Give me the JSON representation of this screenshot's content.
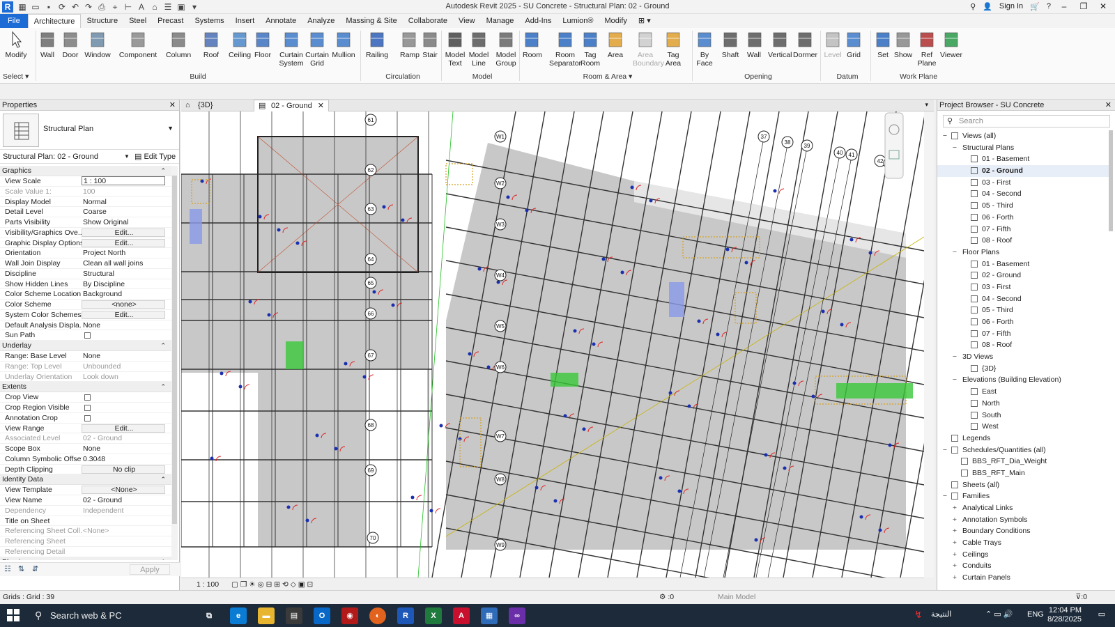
{
  "window": {
    "title": "Autodesk Revit 2025 - SU Concrete - Structural Plan: 02 - Ground",
    "sign_in": "Sign In"
  },
  "ribbon_tabs": [
    "File",
    "Architecture",
    "Structure",
    "Steel",
    "Precast",
    "Systems",
    "Insert",
    "Annotate",
    "Analyze",
    "Massing & Site",
    "Collaborate",
    "View",
    "Manage",
    "Add-Ins",
    "Lumion®",
    "Modify"
  ],
  "ribbon": {
    "select": "Select ▾",
    "tools": [
      {
        "label": "Modify"
      },
      {
        "label": "Wall"
      },
      {
        "label": "Door"
      },
      {
        "label": "Window"
      },
      {
        "label": "Component"
      },
      {
        "label": "Column"
      },
      {
        "label": "Roof"
      },
      {
        "label": "Ceiling"
      },
      {
        "label": "Floor"
      },
      {
        "label": "Curtain\nSystem"
      },
      {
        "label": "Curtain\nGrid"
      },
      {
        "label": "Mullion"
      },
      {
        "label": "Railing"
      },
      {
        "label": "Ramp"
      },
      {
        "label": "Stair"
      },
      {
        "label": "Model\nText"
      },
      {
        "label": "Model\nLine"
      },
      {
        "label": "Model\nGroup"
      },
      {
        "label": "Room"
      },
      {
        "label": "Room\nSeparator"
      },
      {
        "label": "Tag\nRoom"
      },
      {
        "label": "Area"
      },
      {
        "label": "Area\nBoundary"
      },
      {
        "label": "Tag\nArea"
      },
      {
        "label": "By\nFace"
      },
      {
        "label": "Shaft"
      },
      {
        "label": "Wall"
      },
      {
        "label": "Vertical"
      },
      {
        "label": "Dormer"
      },
      {
        "label": "Level"
      },
      {
        "label": "Grid"
      },
      {
        "label": "Set"
      },
      {
        "label": "Show"
      },
      {
        "label": "Ref\nPlane"
      },
      {
        "label": "Viewer"
      }
    ],
    "panels": {
      "build": "Build",
      "circulation": "Circulation",
      "model": "Model",
      "room_area": "Room & Area ▾",
      "opening": "Opening",
      "datum": "Datum",
      "work_plane": "Work Plane"
    }
  },
  "properties": {
    "header": "Properties",
    "type_name": "Structural Plan",
    "instance": "Structural Plan: 02 - Ground",
    "edit_type": "Edit Type",
    "groups": [
      {
        "name": "Graphics",
        "rows": [
          {
            "k": "View Scale",
            "v": "1 : 100",
            "kind": "inp"
          },
          {
            "k": "Scale Value    1:",
            "v": "100",
            "kind": "dim"
          },
          {
            "k": "Display Model",
            "v": "Normal"
          },
          {
            "k": "Detail Level",
            "v": "Coarse"
          },
          {
            "k": "Parts Visibility",
            "v": "Show Original"
          },
          {
            "k": "Visibility/Graphics Ove...",
            "v": "Edit...",
            "kind": "btn"
          },
          {
            "k": "Graphic Display Options",
            "v": "Edit...",
            "kind": "btn"
          },
          {
            "k": "Orientation",
            "v": "Project North"
          },
          {
            "k": "Wall Join Display",
            "v": "Clean all wall joins"
          },
          {
            "k": "Discipline",
            "v": "Structural"
          },
          {
            "k": "Show Hidden Lines",
            "v": "By Discipline"
          },
          {
            "k": "Color Scheme Location",
            "v": "Background"
          },
          {
            "k": "Color Scheme",
            "v": "<none>",
            "kind": "btn"
          },
          {
            "k": "System Color Schemes",
            "v": "Edit...",
            "kind": "btn"
          },
          {
            "k": "Default Analysis Displa...",
            "v": "None"
          },
          {
            "k": "Sun Path",
            "v": "",
            "kind": "chk"
          }
        ]
      },
      {
        "name": "Underlay",
        "rows": [
          {
            "k": "Range: Base Level",
            "v": "None"
          },
          {
            "k": "Range: Top Level",
            "v": "Unbounded",
            "kind": "dim"
          },
          {
            "k": "Underlay Orientation",
            "v": "Look down",
            "kind": "dim"
          }
        ]
      },
      {
        "name": "Extents",
        "rows": [
          {
            "k": "Crop View",
            "v": "",
            "kind": "chk"
          },
          {
            "k": "Crop Region Visible",
            "v": "",
            "kind": "chk"
          },
          {
            "k": "Annotation Crop",
            "v": "",
            "kind": "chk"
          },
          {
            "k": "View Range",
            "v": "Edit...",
            "kind": "btn"
          },
          {
            "k": "Associated Level",
            "v": "02 - Ground",
            "kind": "dim"
          },
          {
            "k": "Scope Box",
            "v": "None"
          },
          {
            "k": "Column Symbolic Offset",
            "v": "0.3048"
          },
          {
            "k": "Depth Clipping",
            "v": "No clip",
            "kind": "btn"
          }
        ]
      },
      {
        "name": "Identity Data",
        "rows": [
          {
            "k": "View Template",
            "v": "<None>",
            "kind": "btn"
          },
          {
            "k": "View Name",
            "v": "02 - Ground"
          },
          {
            "k": "Dependency",
            "v": "Independent",
            "kind": "dim"
          },
          {
            "k": "Title on Sheet",
            "v": ""
          },
          {
            "k": "Referencing Sheet Coll...",
            "v": "<None>",
            "kind": "dim"
          },
          {
            "k": "Referencing Sheet",
            "v": "",
            "kind": "dim"
          },
          {
            "k": "Referencing Detail",
            "v": "",
            "kind": "dim"
          }
        ]
      },
      {
        "name": "Phasing",
        "rows": []
      }
    ],
    "apply": "Apply"
  },
  "view_tabs": [
    {
      "label": "{3D}",
      "active": false
    },
    {
      "label": "02 - Ground",
      "active": true
    }
  ],
  "view_control": {
    "scale": "1 : 100"
  },
  "browser": {
    "header": "Project Browser - SU Concrete",
    "search_placeholder": "Search",
    "tree": [
      {
        "label": "Views (all)",
        "lvl": 0,
        "tg": "−",
        "ic": true
      },
      {
        "label": "Structural Plans",
        "lvl": 1,
        "tg": "−"
      },
      {
        "label": "01 - Basement",
        "lvl": 2,
        "ic": true
      },
      {
        "label": "02 - Ground",
        "lvl": 2,
        "ic": true,
        "sel": true
      },
      {
        "label": "03 - First",
        "lvl": 2,
        "ic": true
      },
      {
        "label": "04 - Second",
        "lvl": 2,
        "ic": true
      },
      {
        "label": "05 - Third",
        "lvl": 2,
        "ic": true
      },
      {
        "label": "06 - Forth",
        "lvl": 2,
        "ic": true
      },
      {
        "label": "07 - Fifth",
        "lvl": 2,
        "ic": true
      },
      {
        "label": "08 - Roof",
        "lvl": 2,
        "ic": true
      },
      {
        "label": "Floor Plans",
        "lvl": 1,
        "tg": "−"
      },
      {
        "label": "01 - Basement",
        "lvl": 2,
        "ic": true
      },
      {
        "label": "02 - Ground",
        "lvl": 2,
        "ic": true
      },
      {
        "label": "03 - First",
        "lvl": 2,
        "ic": true
      },
      {
        "label": "04 - Second",
        "lvl": 2,
        "ic": true
      },
      {
        "label": "05 - Third",
        "lvl": 2,
        "ic": true
      },
      {
        "label": "06 - Forth",
        "lvl": 2,
        "ic": true
      },
      {
        "label": "07 - Fifth",
        "lvl": 2,
        "ic": true
      },
      {
        "label": "08 - Roof",
        "lvl": 2,
        "ic": true
      },
      {
        "label": "3D Views",
        "lvl": 1,
        "tg": "−"
      },
      {
        "label": "{3D}",
        "lvl": 2,
        "ic": true
      },
      {
        "label": "Elevations (Building Elevation)",
        "lvl": 1,
        "tg": "−"
      },
      {
        "label": "East",
        "lvl": 2,
        "ic": true
      },
      {
        "label": "North",
        "lvl": 2,
        "ic": true
      },
      {
        "label": "South",
        "lvl": 2,
        "ic": true
      },
      {
        "label": "West",
        "lvl": 2,
        "ic": true
      },
      {
        "label": "Legends",
        "lvl": 0,
        "ic": true
      },
      {
        "label": "Schedules/Quantities (all)",
        "lvl": 0,
        "tg": "−",
        "ic": true
      },
      {
        "label": "BBS_RFT_Dia_Weight",
        "lvl": 1,
        "ic": true
      },
      {
        "label": "BBS_RFT_Main",
        "lvl": 1,
        "ic": true
      },
      {
        "label": "Sheets (all)",
        "lvl": 0,
        "ic": true
      },
      {
        "label": "Families",
        "lvl": 0,
        "tg": "−",
        "ic": true
      },
      {
        "label": "Analytical Links",
        "lvl": 1,
        "tg": "+"
      },
      {
        "label": "Annotation Symbols",
        "lvl": 1,
        "tg": "+"
      },
      {
        "label": "Boundary Conditions",
        "lvl": 1,
        "tg": "+"
      },
      {
        "label": "Cable Trays",
        "lvl": 1,
        "tg": "+"
      },
      {
        "label": "Ceilings",
        "lvl": 1,
        "tg": "+"
      },
      {
        "label": "Conduits",
        "lvl": 1,
        "tg": "+"
      },
      {
        "label": "Curtain Panels",
        "lvl": 1,
        "tg": "+"
      }
    ]
  },
  "grid_bubbles": [
    "61",
    "62",
    "63",
    "64",
    "65",
    "66",
    "67",
    "68",
    "69",
    "70",
    "W1",
    "W2",
    "W3",
    "W4",
    "W5",
    "W6",
    "W7",
    "W8",
    "W9",
    "37",
    "38",
    "39",
    "40",
    "41",
    "42",
    "43"
  ],
  "status": {
    "text": "Grids : Grid : 39",
    "main_model": "Main Model",
    "zero": ":0"
  },
  "taskbar": {
    "search": "Search web & PC",
    "lang": "ENG",
    "time": "12:04 PM",
    "date": "8/28/2025",
    "weather": "النتيجة"
  },
  "colors": {
    "file_tab": "#1d6bd5",
    "room_fill": "#c8c8c8",
    "door_red": "#e02020",
    "grid_blue": "#1a2fb0"
  }
}
